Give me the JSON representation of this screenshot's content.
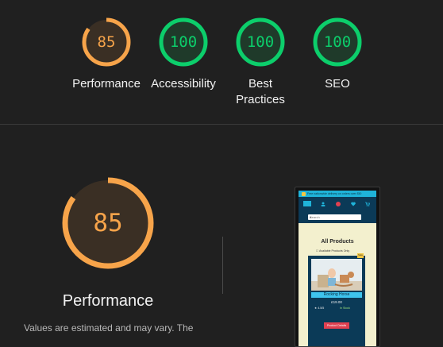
{
  "colors": {
    "background": "#202020",
    "gauge_average": "#f7a44a",
    "gauge_pass": "#0cce6b",
    "gauge_average_fill": "#3a2f24",
    "gauge_pass_fill": "#1f3a2a"
  },
  "scores": [
    {
      "label": "Performance",
      "value": 85,
      "status": "average"
    },
    {
      "label": "Accessibility",
      "value": 100,
      "status": "pass"
    },
    {
      "label": "Best\nPractices",
      "value": 100,
      "status": "pass"
    },
    {
      "label": "SEO",
      "value": 100,
      "status": "pass"
    }
  ],
  "detail": {
    "score": 85,
    "title": "Performance",
    "note": "Values are estimated and may vary. The"
  },
  "screenshot": {
    "promo_text": "Free nationwide delivery on orders over £50",
    "search_placeholder": "Search",
    "heading": "All Products",
    "available_filter": "Available Products Only",
    "sale_badge": "Sale",
    "product": {
      "name": "Rocking Horse",
      "price": "£19.00",
      "rating": "★ 4.5/5",
      "stock": "In Stock",
      "button": "Product Details"
    }
  }
}
